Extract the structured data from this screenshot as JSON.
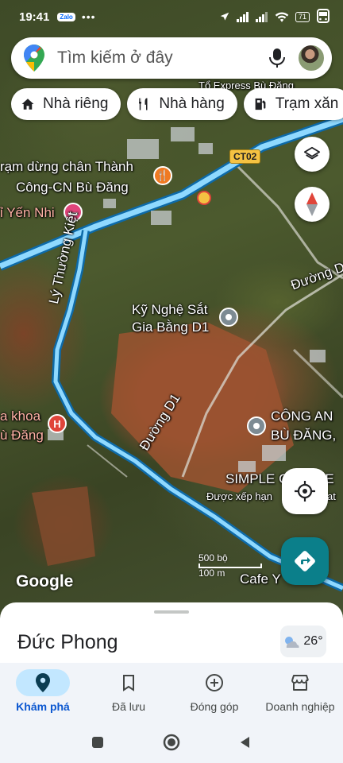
{
  "status_bar": {
    "time": "19:41",
    "notification_app": "Zalo",
    "overflow": "•••",
    "battery": "71"
  },
  "search": {
    "placeholder": "Tìm kiếm ở đây"
  },
  "chips": [
    {
      "label": "Nhà riêng",
      "icon": "home-icon"
    },
    {
      "label": "Nhà hàng",
      "icon": "restaurant-icon"
    },
    {
      "label": "Trạm xăn",
      "icon": "gas-station-icon"
    }
  ],
  "map": {
    "labels": {
      "top_cut": "Tổ Express Bù Đăng",
      "rest_stop_1": "rạm dừng chân Thành",
      "rest_stop_2": "Công-CN Bù Đăng",
      "hotel": "ỉ Yến Nhi",
      "road_ct02": "CT02",
      "street_ly_thuong_kiet": "Lý Thường Kiệt",
      "street_d1_top": "Đường D",
      "metal_shop_1": "Kỹ Nghệ Sắt",
      "metal_shop_2": "Gia Bằng D1",
      "clinic_1": "a khoa",
      "clinic_2": "ù Đăng",
      "street_d1": "Đường D1",
      "police_1": "CÔNG AN",
      "police_2": "BÙ ĐĂNG,",
      "coffee_1": "SIMPLE C",
      "coffee_1b": "EE",
      "coffee_2": "Được xếp hạn",
      "coffee_2b": "at",
      "cafe": "Cafe Y",
      "google": "Google",
      "scale_1": "500 bộ",
      "scale_2": "100 m"
    }
  },
  "bottom_sheet": {
    "place_name": "Đức Phong",
    "temperature": "26°"
  },
  "bottom_nav": [
    {
      "label": "Khám phá",
      "icon": "explore-pin-icon",
      "active": true
    },
    {
      "label": "Đã lưu",
      "icon": "bookmark-icon",
      "active": false
    },
    {
      "label": "Đóng góp",
      "icon": "add-circle-icon",
      "active": false
    },
    {
      "label": "Doanh nghiệp",
      "icon": "storefront-icon",
      "active": false
    }
  ],
  "colors": {
    "route": "#4fc3f7",
    "accent": "#0b57d0",
    "directions_button": "#0b7f8a"
  }
}
